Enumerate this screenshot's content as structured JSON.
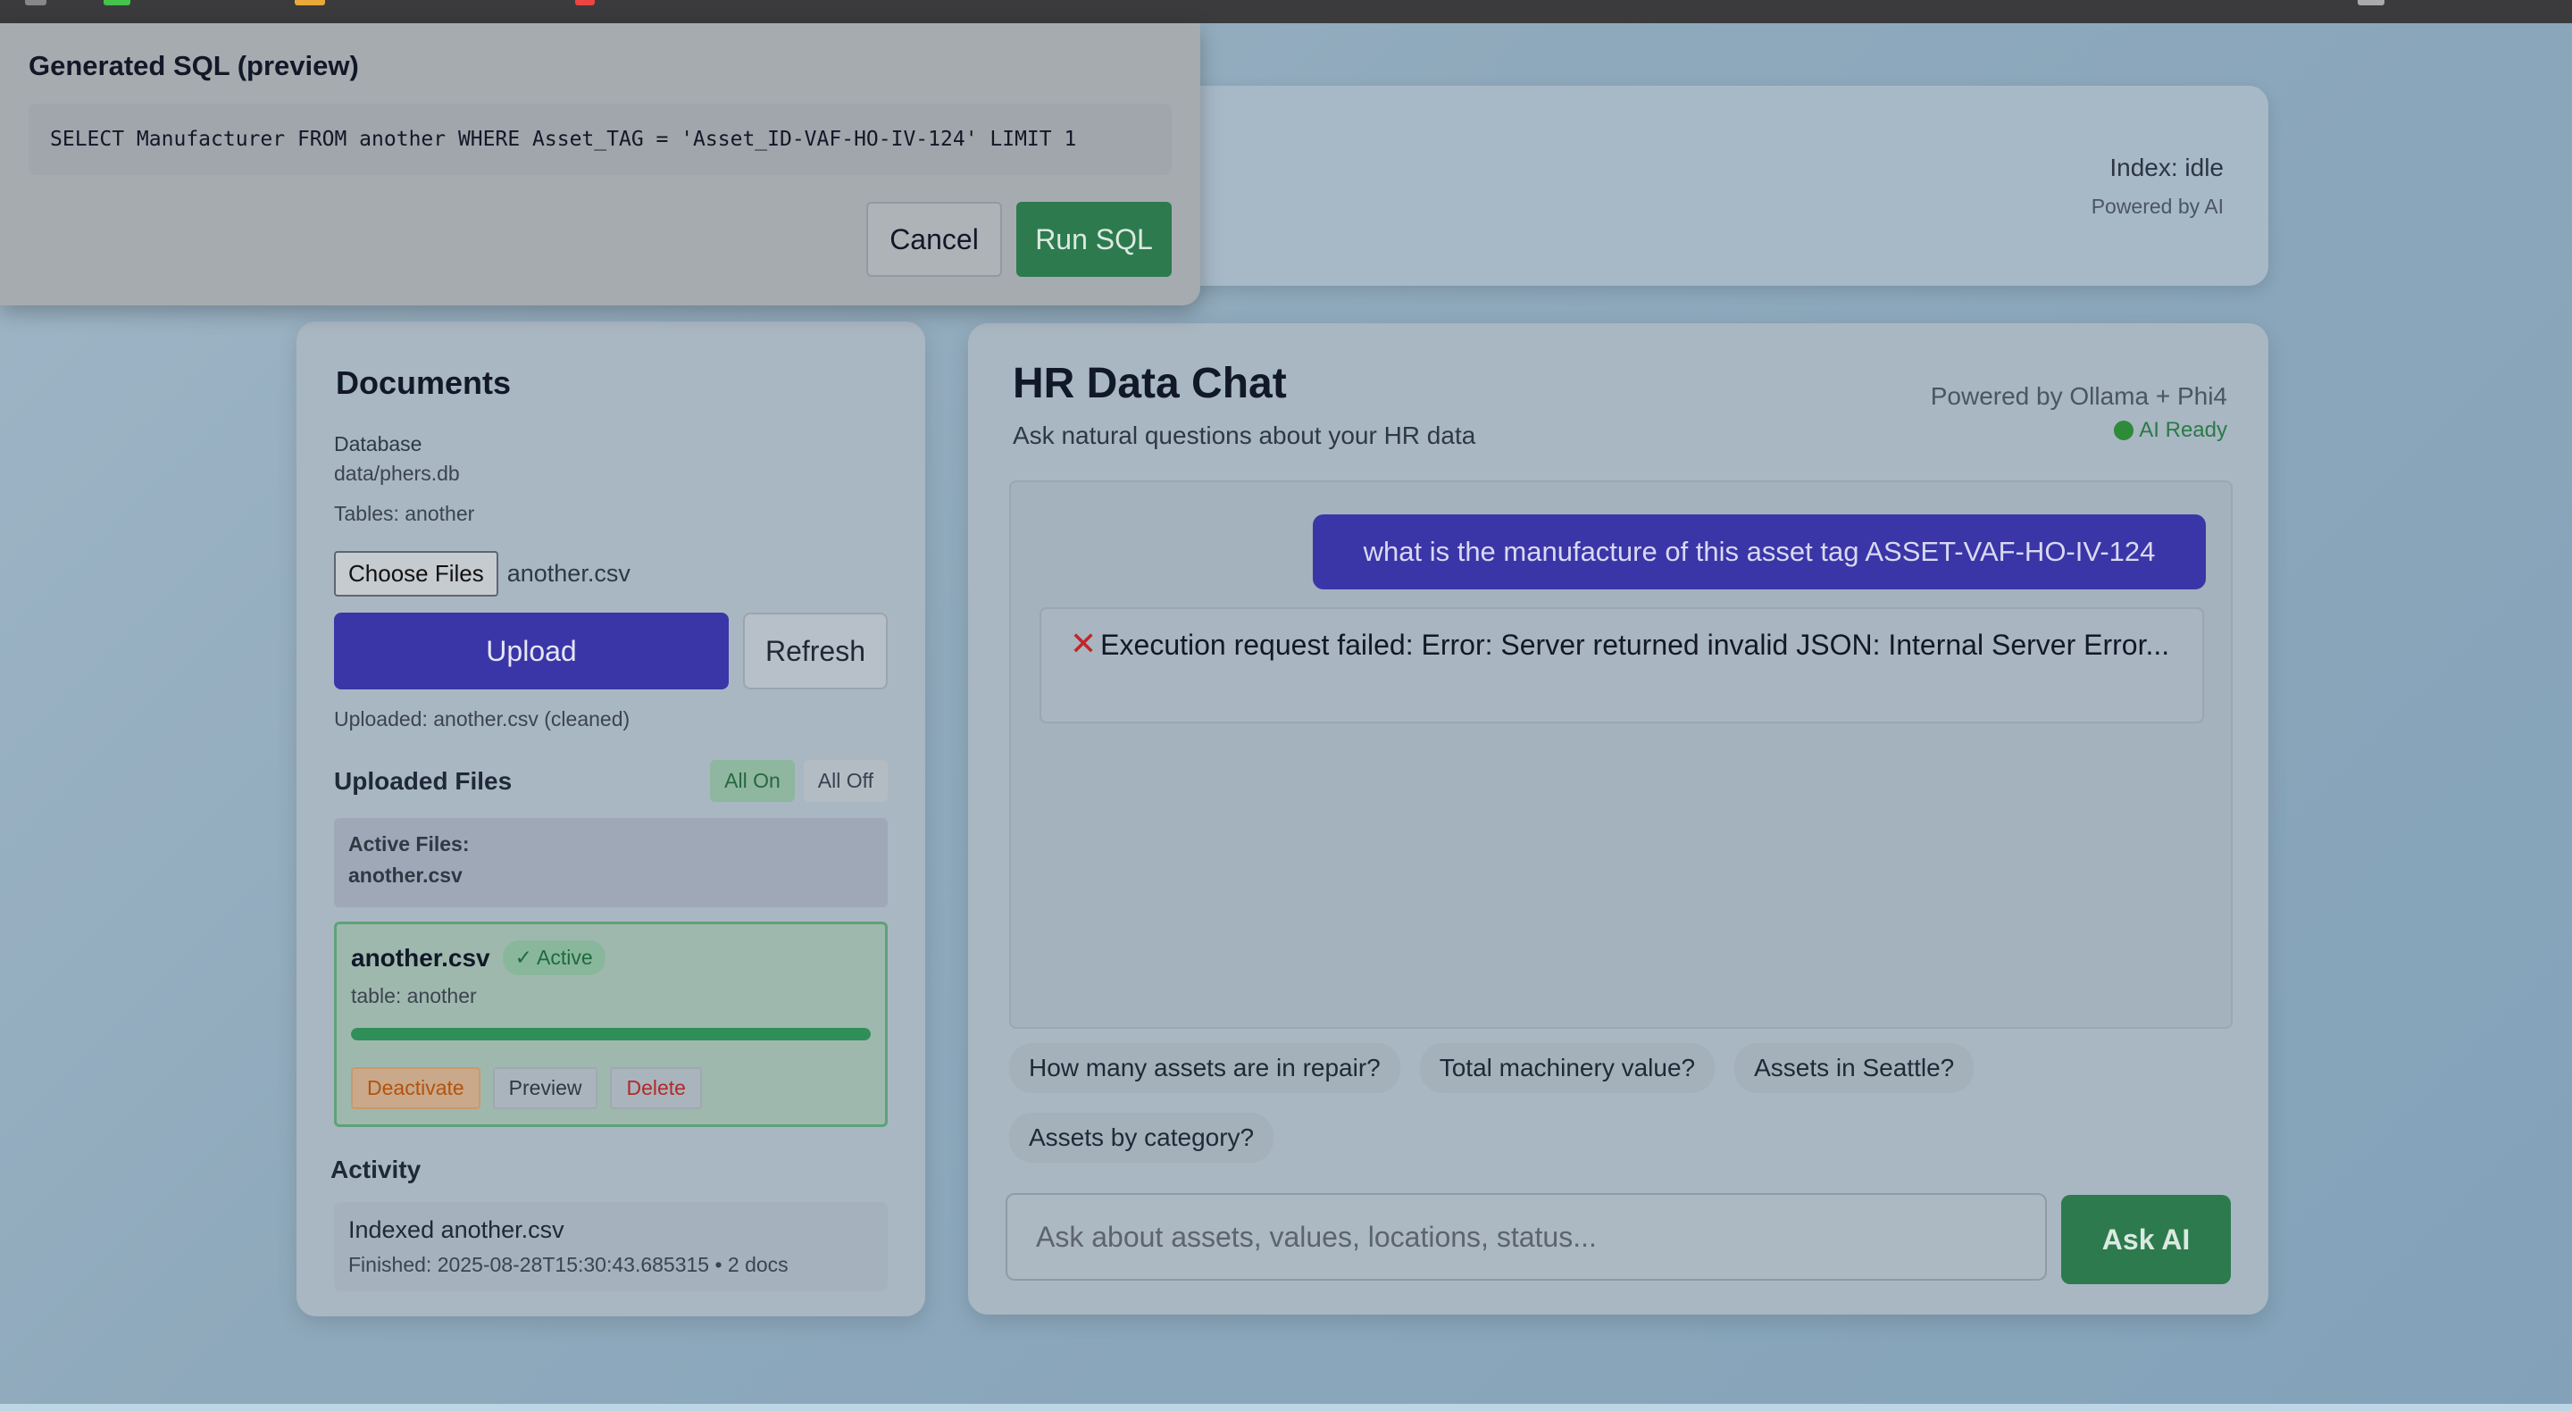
{
  "header": {
    "index_status": "Index: idle",
    "powered": "Powered by AI"
  },
  "sql_modal": {
    "title": "Generated SQL (preview)",
    "sql": "SELECT Manufacturer FROM another WHERE Asset_TAG = 'Asset_ID-VAF-HO-IV-124' LIMIT 1",
    "cancel_label": "Cancel",
    "run_label": "Run SQL"
  },
  "documents": {
    "title": "Documents",
    "database_label": "Database",
    "database_path": "data/phers.db",
    "tables": "Tables: another",
    "choose_label": "Choose Files",
    "chosen_file": "another.csv",
    "upload_label": "Upload",
    "refresh_label": "Refresh",
    "uploaded_note": "Uploaded: another.csv (cleaned)",
    "uploaded_files_title": "Uploaded Files",
    "all_on_label": "All On",
    "all_off_label": "All Off",
    "active_files_label": "Active Files:",
    "active_files_value": "another.csv",
    "file_card": {
      "name": "another.csv",
      "status": "✓ Active",
      "table": "table: another",
      "progress": 1.0,
      "deactivate_label": "Deactivate",
      "preview_label": "Preview",
      "delete_label": "Delete"
    },
    "activity_title": "Activity",
    "activity_item": {
      "title": "Indexed another.csv",
      "subtitle": "Finished: 2025-08-28T15:30:43.685315 • 2 docs"
    }
  },
  "chat": {
    "title": "HR Data Chat",
    "subtitle": "Ask natural questions about your HR data",
    "powered": "Powered by Ollama + Phi4",
    "ai_status": "AI Ready",
    "user_message": "what is the manufacture of this asset tag ASSET-VAF-HO-IV-124",
    "bot_message": "Execution request failed: Error: Server returned invalid JSON: Internal Server Error...",
    "suggestions": [
      "How many assets are in repair?",
      "Total machinery value?",
      "Assets in Seattle?",
      "Assets by category?"
    ],
    "input_placeholder": "Ask about assets, values, locations, status...",
    "ask_label": "Ask AI"
  },
  "colors": {
    "primary": "#3a36a8",
    "success": "#2d7a4f",
    "danger": "#c0262a"
  }
}
